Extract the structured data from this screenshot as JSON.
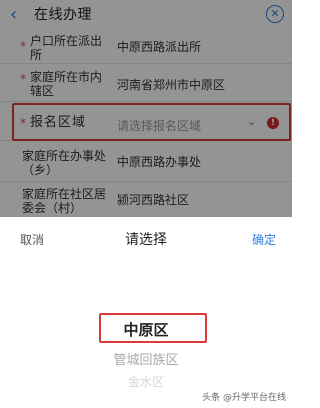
{
  "header": {
    "title": "在线办理",
    "back_icon": "chevron-left-icon",
    "close_icon": "close-circle-icon"
  },
  "form": {
    "rows": [
      {
        "required": true,
        "label": "户口所在派出所",
        "value": "中原西路派出所"
      },
      {
        "required": true,
        "label": "家庭所在市内辖区",
        "value": "河南省郑州市中原区"
      },
      {
        "required": true,
        "label": "报名区域",
        "placeholder": "请选择报名区域",
        "chevron_icon": "chevron-down-icon",
        "alert_icon": "exclamation-icon"
      },
      {
        "required": false,
        "label": "家庭所在办事处（乡）",
        "value": "中原西路办事处"
      },
      {
        "required": false,
        "label": "家庭所在社区居委会（村）",
        "value": "颍河西路社区"
      }
    ],
    "asterisk": "*"
  },
  "picker": {
    "cancel_label": "取消",
    "title": "请选择",
    "confirm_label": "确定",
    "options": [
      "中原区",
      "管城回族区",
      "金水区"
    ],
    "selected_index": 0
  },
  "watermark": "头条 @升学平台在线",
  "colors": {
    "accent": "#2f7fe0",
    "highlight": "#d93b3b",
    "overlay": "rgba(0,0,0,0.42)"
  }
}
